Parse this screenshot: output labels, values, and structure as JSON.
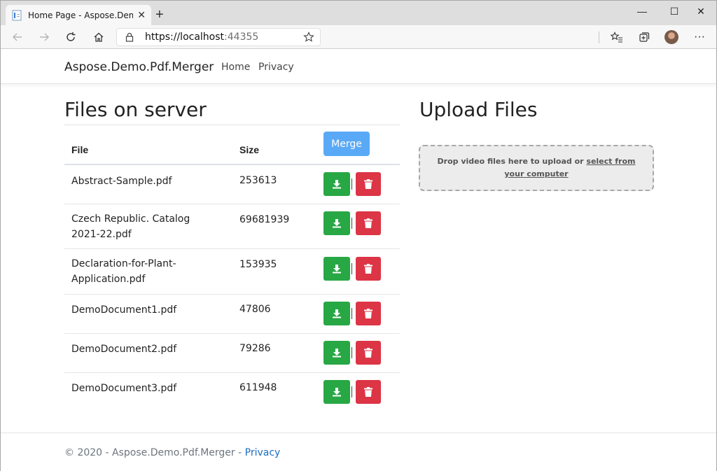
{
  "browser": {
    "tab_title": "Home Page - Aspose.Demo.Pdf.M",
    "tab_close": "✕",
    "new_tab": "+",
    "address_host": "https://localhost",
    "address_port": ":44355",
    "window_minimize": "—",
    "window_maximize": "☐",
    "window_close": "✕",
    "more_menu": "···",
    "icons": [
      "back-icon",
      "forward-icon",
      "refresh-icon",
      "home-icon",
      "lock-icon",
      "star-icon",
      "favorites-icon",
      "collections-icon",
      "profile-avatar",
      "more-icon"
    ]
  },
  "navbar": {
    "brand": "Aspose.Demo.Pdf.Merger",
    "links": [
      "Home",
      "Privacy"
    ]
  },
  "files": {
    "title": "Files on server",
    "headers": {
      "file": "File",
      "size": "Size"
    },
    "merge_label": "Merge",
    "rows": [
      {
        "file": "Abstract-Sample.pdf",
        "size": "253613"
      },
      {
        "file": "Czech Republic. Catalog 2021-22.pdf",
        "size": "69681939"
      },
      {
        "file": "Declaration-for-Plant-Application.pdf",
        "size": "153935"
      },
      {
        "file": "DemoDocument1.pdf",
        "size": "47806"
      },
      {
        "file": "DemoDocument2.pdf",
        "size": "79286"
      },
      {
        "file": "DemoDocument3.pdf",
        "size": "611948"
      }
    ]
  },
  "upload": {
    "title": "Upload Files",
    "drop_text": "Drop video files here to upload or ",
    "drop_link": "select from your computer"
  },
  "footer": {
    "text": "© 2020 - Aspose.Demo.Pdf.Merger - ",
    "link": "Privacy"
  },
  "colors": {
    "download": "#28a745",
    "delete": "#dc3545",
    "merge": "#5aa9f6",
    "link": "#1b6ec2"
  }
}
